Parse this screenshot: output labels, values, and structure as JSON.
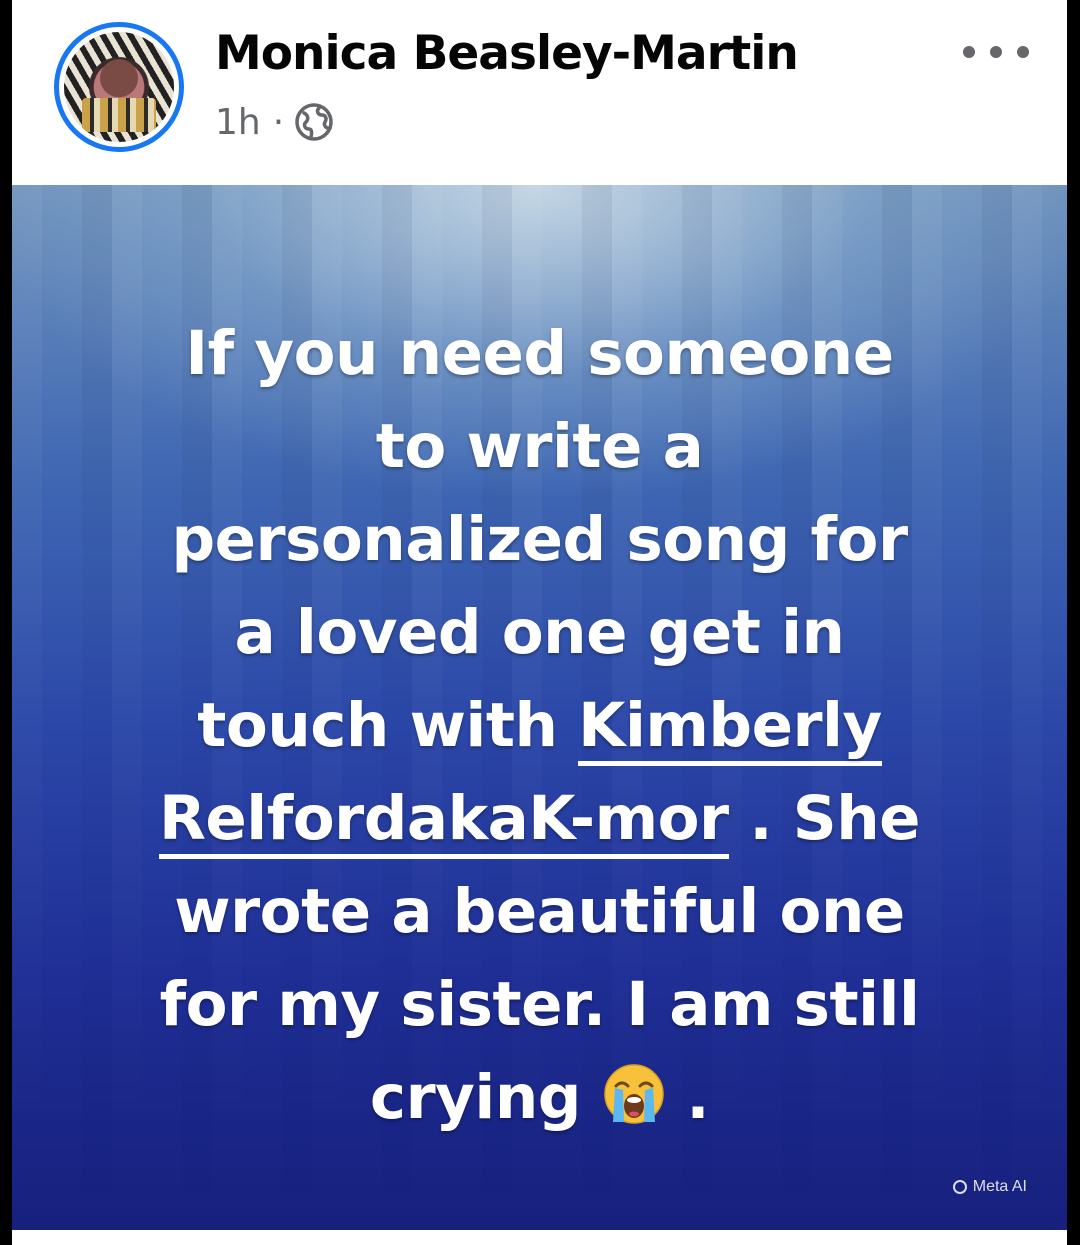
{
  "post": {
    "author": "Monica Beasley-Martin",
    "time": "1h",
    "separator": "·",
    "privacy_icon": "globe-icon",
    "more_icon": "more-options-icon",
    "text_lines": {
      "l1": "If you need someone",
      "l2": "to write a",
      "l3": "personalized song for",
      "l4": "a loved one get in",
      "l5_prefix": "touch with ",
      "mention_part1": "Kimberly",
      "mention_part2": "RelfordakaK-mor",
      "l6_suffix": " . She",
      "l7": "wrote a beautiful one",
      "l8": "for my sister. I am still",
      "l9_prefix": "crying ",
      "l9_suffix": " ."
    },
    "emoji": "loudly-crying-face-icon",
    "badge": "Meta AI"
  },
  "colors": {
    "accent_ring": "#1877f2",
    "post_bg_top": "#6f93bd",
    "post_bg_bottom": "#17207d"
  }
}
